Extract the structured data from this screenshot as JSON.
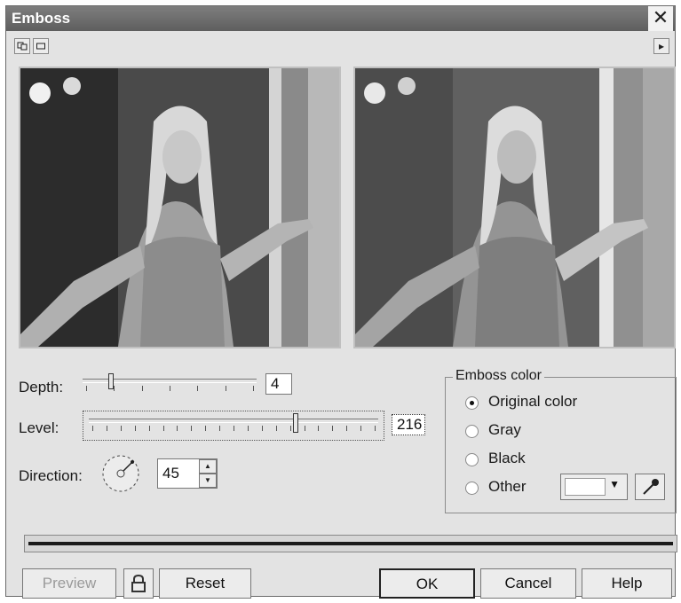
{
  "dialog": {
    "title": "Emboss",
    "close_glyph": "✕"
  },
  "toolbar": {
    "toggle_view_icon": "dual-preview-icon",
    "single_view_icon": "single-preview-icon",
    "menu_arrow": "▸"
  },
  "previews": {
    "original_alt": "original-image-preview",
    "result_alt": "embossed-image-preview"
  },
  "controls": {
    "depth_label": "Depth:",
    "depth_value": "4",
    "depth_fraction": 0.15,
    "level_label": "Level:",
    "level_value": "216",
    "level_fraction": 0.72,
    "direction_label": "Direction:",
    "direction_value": "45"
  },
  "emboss_color": {
    "title": "Emboss color",
    "options": [
      "Original color",
      "Gray",
      "Black",
      "Other"
    ],
    "selected": "Original color",
    "swatch_color": "#ffffff"
  },
  "buttons": {
    "preview": "Preview",
    "reset": "Reset",
    "ok": "OK",
    "cancel": "Cancel",
    "help": "Help"
  }
}
